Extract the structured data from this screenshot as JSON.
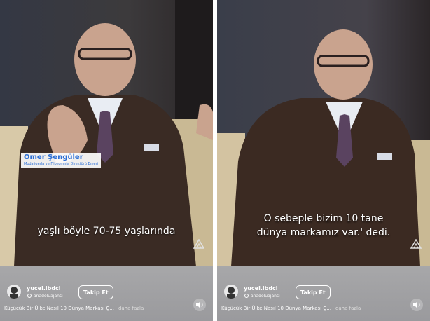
{
  "panels": [
    {
      "subtitle": "yaşlı böyle 70-75 yaşlarında",
      "name_tag": {
        "name": "Ömer Şengüler",
        "title": "Modaligerla ve Filozomnia Direktörü Emeri"
      },
      "account": {
        "username": "yucel.lbdci",
        "handle": "anadoluajansi"
      },
      "follow_label": "Takip Et",
      "caption": "Küçücük Bir Ülke Nasıl 10 Dünya Markası Ç...",
      "caption_more": "daha fazla"
    },
    {
      "subtitle_line1": "O sebeple bizim 10 tane",
      "subtitle_line2": "dünya markamız var.' dedi.",
      "account": {
        "username": "yucel.lbdci",
        "handle": "anadoluajansi"
      },
      "follow_label": "Takip Et",
      "caption": "Küçücük Bir Ülke Nasıl 10 Dünya Markası Ç...",
      "caption_more": "daha fazla"
    }
  ],
  "colors": {
    "name_tag_text": "#2c6fd6",
    "suit": "#3b2a22",
    "bottom_bar": "#a0a0a3"
  },
  "icons": {
    "logo": "aa-logo-icon",
    "sound": "speaker-icon",
    "avatar": "avatar-icon"
  }
}
